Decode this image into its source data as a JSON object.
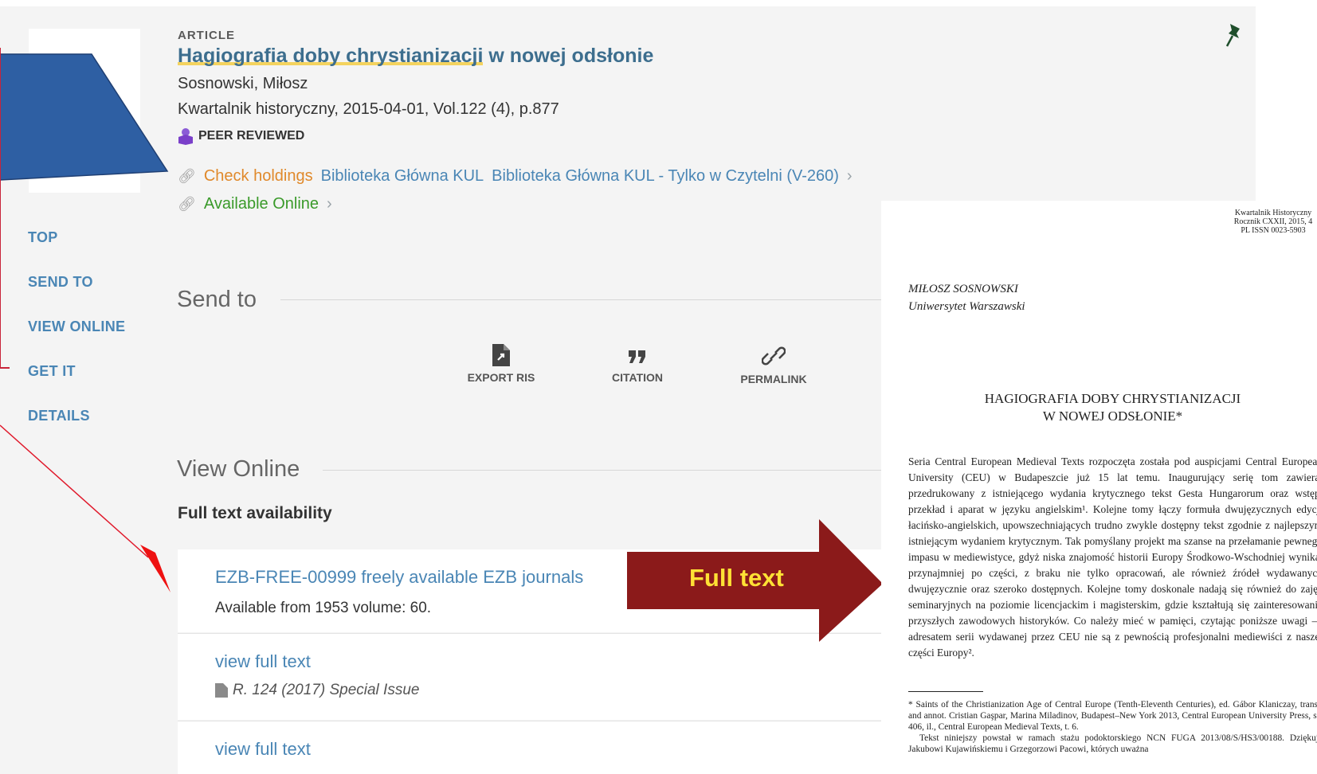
{
  "record": {
    "type": "ARTICLE",
    "title_highlight": "Hagiografia doby chrystianizacji",
    "title_rest": " w nowej odsłonie",
    "author": "Sosnowski, Miłosz",
    "source": "Kwartalnik historyczny, 2015-04-01, Vol.122 (4), p.877",
    "peer_reviewed": "PEER REVIEWED",
    "check_holdings": "Check holdings",
    "library_1": "Biblioteka Główna KUL",
    "library_2": "Biblioteka Główna KUL - Tylko w Czytelni (V-260)",
    "available_online": "Available Online"
  },
  "nav": {
    "top": "TOP",
    "send_to": "SEND TO",
    "view_online": "VIEW ONLINE",
    "get_it": "GET IT",
    "details": "DETAILS"
  },
  "send_to": {
    "title": "Send to",
    "export_ris": "EXPORT RIS",
    "citation": "CITATION",
    "permalink": "PERMALINK"
  },
  "view_online": {
    "title": "View Online",
    "subtitle": "Full text availability",
    "items": [
      {
        "link": "EZB-FREE-00999 freely available EZB journals",
        "note": "Available from 1953 volume: 60."
      },
      {
        "link": "view full text",
        "note": "R. 124 (2017) Special Issue"
      },
      {
        "link": "view full text"
      }
    ]
  },
  "annotation": {
    "full_text": "Full text",
    "arrow_color": "#8b1a1a",
    "callout_color": "#2e5fa3"
  },
  "pdf": {
    "header_1": "Kwartalnik Historyczny",
    "header_2": "Rocznik CXXII, 2015, 4",
    "header_3": "PL ISSN 0023-5903",
    "author": "MIŁOSZ SOSNOWSKI",
    "affiliation": "Uniwersytet Warszawski",
    "title_1": "HAGIOGRAFIA DOBY CHRYSTIANIZACJI",
    "title_2": "W NOWEJ ODSŁONIE*",
    "body": "Seria Central European Medieval Texts rozpoczęta została pod auspicjami Central European University (CEU) w Budapeszcie już 15 lat temu. Inaugurujący serię tom zawierał przedrukowany z istniejącego wydania krytycznego tekst Gesta Hungarorum oraz wstęp, przekład i aparat w języku angielskim¹. Kolejne tomy łączy formuła dwujęzycznych edycji łacińsko-angielskich, upowszechniających trudno zwykle dostępny tekst zgodnie z najlepszym istniejącym wydaniem krytycznym. Tak pomyślany projekt ma szanse na przełamanie pewnego impasu w mediewistyce, gdyż niska znajomość historii Europy Środkowo-Wschodniej wynika, przynajmniej po części, z braku nie tylko opracowań, ale również źródeł wydawanych dwujęzycznie oraz szeroko dostępnych. Kolejne tomy doskonale nadają się również do zajęć seminaryjnych na poziomie licencjackim i magisterskim, gdzie kształtują się zainteresowania przyszłych zawodowych historyków. Co należy mieć w pamięci, czytając poniższe uwagi — adresatem serii wydawanej przez CEU nie są z pewnością profesjonalni mediewiści z naszej części Europy².",
    "footnote_1": "* Saints of the Christianization Age of Central Europe (Tenth-Eleventh Centuries), ed. Gábor Klaniczay, transl. and annot. Cristian Gaşpar, Marina Miladinov, Budapest–New York 2013, Central European University Press, ss. 406, il., Central European Medieval Texts, t. 6.",
    "footnote_2": "Tekst niniejszy powstał w ramach stażu podoktorskiego NCN FUGA 2013/08/S/HS3/00188. Dziękuję Jakubowi Kujawińskiemu i Grzegorzowi Pacowi, których uważna"
  }
}
